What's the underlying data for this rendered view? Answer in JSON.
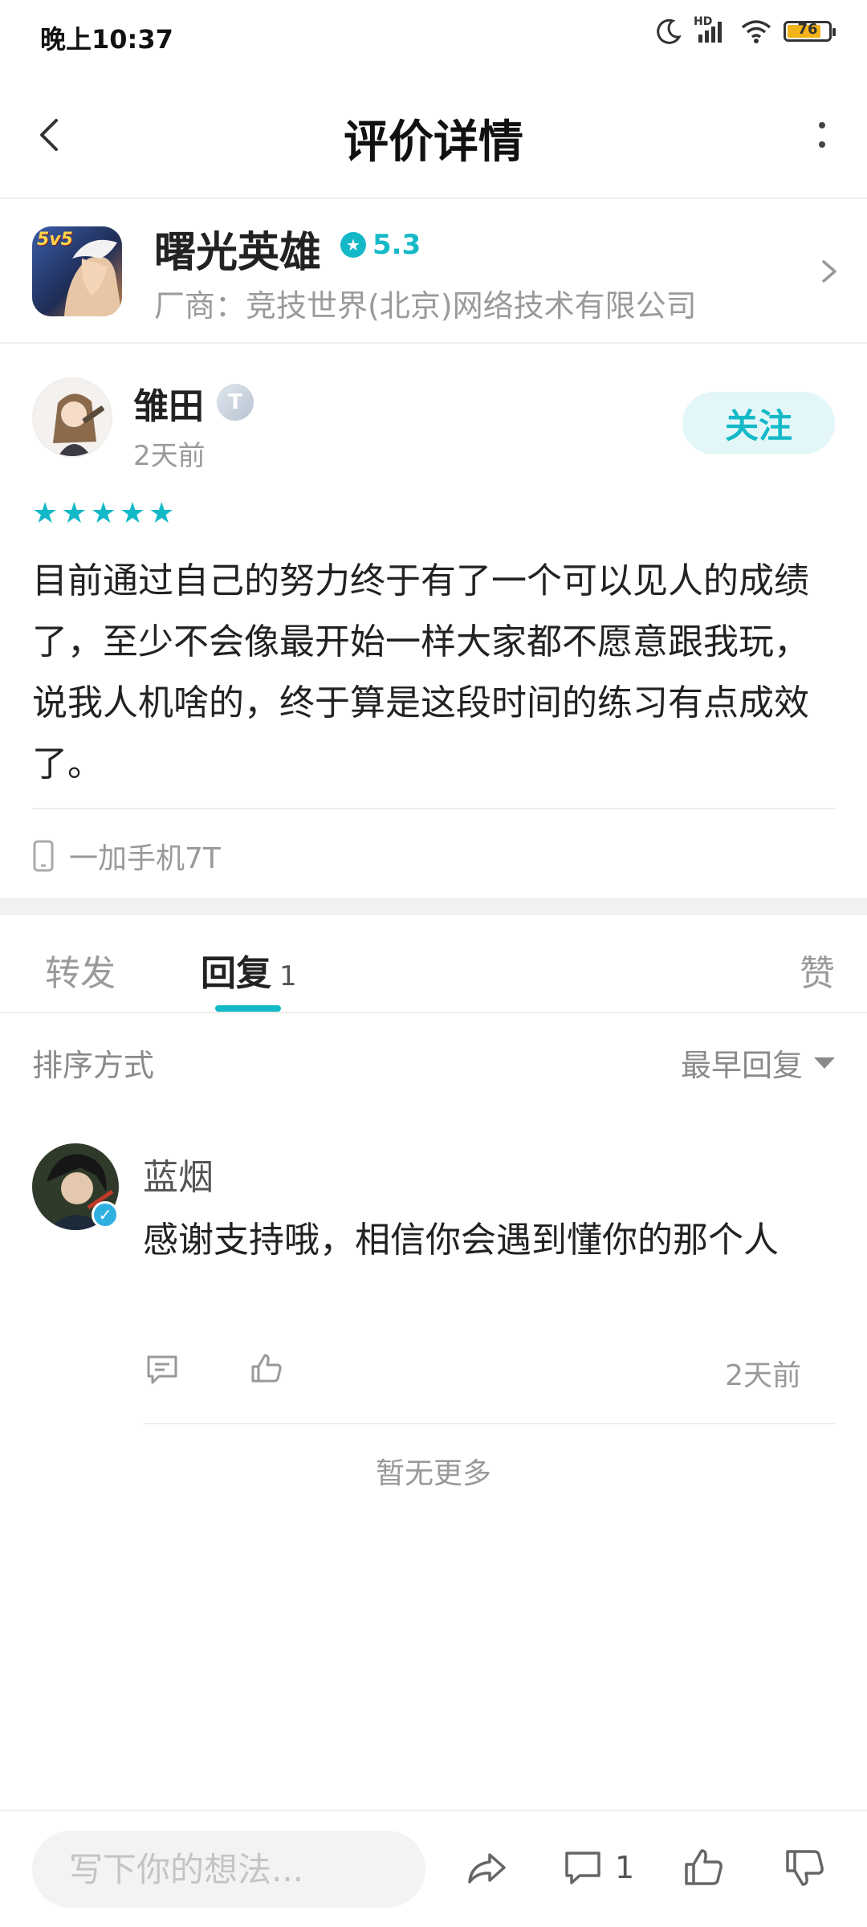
{
  "status_bar": {
    "time": "晚上10:37",
    "battery": "76",
    "network": "HD"
  },
  "header": {
    "title": "评价详情"
  },
  "app": {
    "icon_label": "5v5",
    "name": "曙光英雄",
    "rating": "5.3",
    "vendor": "厂商：竞技世界(北京)网络技术有限公司"
  },
  "review": {
    "author": "雏田",
    "level_badge": "T",
    "time": "2天前",
    "follow_label": "关注",
    "stars": 5,
    "text": "目前通过自己的努力终于有了一个可以见人的成绩了，至少不会像最开始一样大家都不愿意跟我玩，说我人机啥的，终于算是这段时间的练习有点成效了。",
    "device": "一加手机7T"
  },
  "tabs": {
    "forward": "转发",
    "reply": "回复",
    "reply_count": "1",
    "like": "赞"
  },
  "sort": {
    "label": "排序方式",
    "value": "最早回复"
  },
  "reply": {
    "author": "蓝烟",
    "text": "感谢支持哦，相信你会遇到懂你的那个人",
    "time": "2天前"
  },
  "footer_note": "暂无更多",
  "bottom_bar": {
    "placeholder": "写下你的想法...",
    "comment_count": "1"
  },
  "colors": {
    "accent": "#14b9c8",
    "follow_bg": "#e4f7f8",
    "muted_text": "#9a9a9a",
    "battery_fill": "#f2b418"
  },
  "icons": [
    "moon-icon",
    "signal-icon",
    "wifi-icon",
    "battery-icon",
    "back-arrow-icon",
    "more-vertical-icon",
    "star-icon",
    "chevron-right-icon",
    "phone-icon",
    "caret-down-icon",
    "verified-icon",
    "comment-icon",
    "thumbs-up-icon",
    "share-icon",
    "thumbs-down-icon"
  ]
}
